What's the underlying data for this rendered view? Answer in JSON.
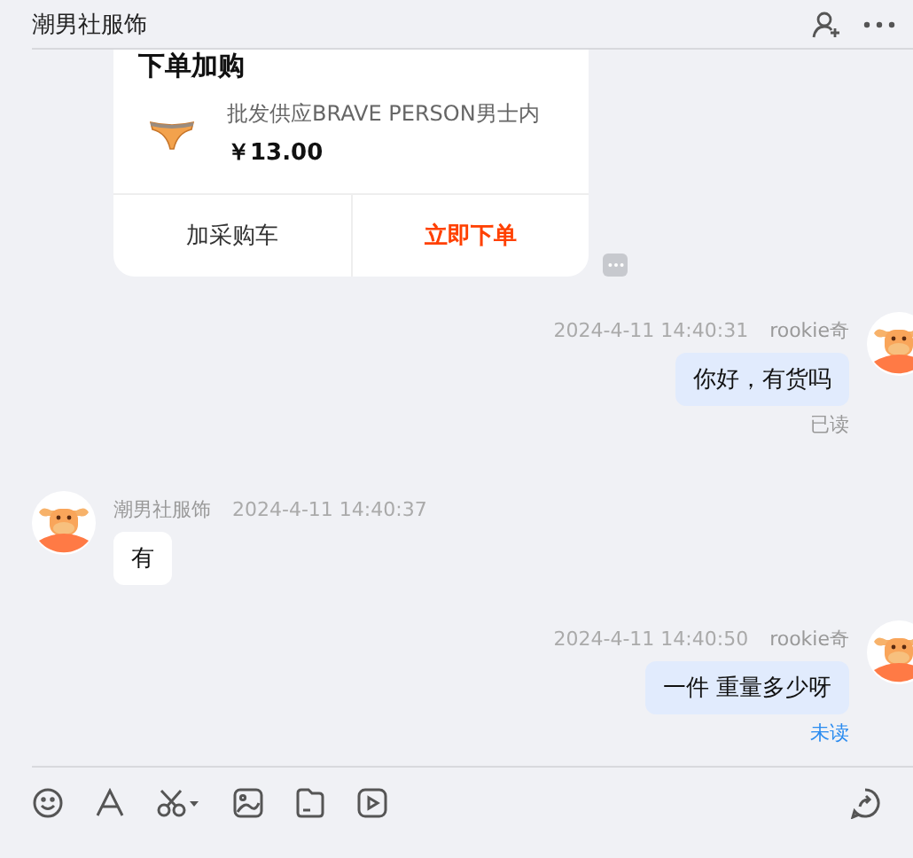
{
  "header": {
    "title": "潮男社服饰"
  },
  "product_card": {
    "heading": "下单加购",
    "product_title": "批发供应BRAVE PERSON男士内",
    "price": "￥13.00",
    "buttons": [
      {
        "label": "加采购车",
        "kind": "secondary"
      },
      {
        "label": "立即下单",
        "kind": "primary"
      }
    ]
  },
  "messages": [
    {
      "kind": "outgoing",
      "sender": "rookie奇",
      "time": "2024-4-11 14:40:31",
      "text": "你好，有货吗",
      "status": "已读",
      "read": true
    },
    {
      "kind": "incoming",
      "sender": "潮男社服饰",
      "time": "2024-4-11 14:40:37",
      "text": "有"
    },
    {
      "kind": "outgoing",
      "sender": "rookie奇",
      "time": "2024-4-11 14:40:50",
      "text": "一件 重量多少呀",
      "status": "未读",
      "read": false
    }
  ]
}
